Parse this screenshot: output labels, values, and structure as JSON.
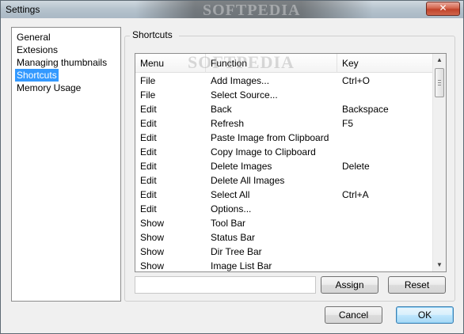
{
  "window": {
    "title": "Settings",
    "title_watermark": "SOFTPEDIA",
    "close_label": "✕"
  },
  "nav": {
    "items": [
      {
        "label": "General",
        "selected": false
      },
      {
        "label": "Extesions",
        "selected": false
      },
      {
        "label": "Managing thumbnails",
        "selected": false
      },
      {
        "label": "Shortcuts",
        "selected": true
      },
      {
        "label": "Memory Usage",
        "selected": false
      }
    ]
  },
  "shortcuts": {
    "group_title": "Shortcuts",
    "watermark": "SOFTPEDIA",
    "columns": [
      "Menu",
      "Function",
      "Key"
    ],
    "rows": [
      {
        "menu": "File",
        "function": "Add Images...",
        "key": "Ctrl+O"
      },
      {
        "menu": "File",
        "function": "Select Source...",
        "key": ""
      },
      {
        "menu": "Edit",
        "function": "Back",
        "key": "Backspace"
      },
      {
        "menu": "Edit",
        "function": "Refresh",
        "key": "F5"
      },
      {
        "menu": "Edit",
        "function": "Paste Image from Clipboard",
        "key": ""
      },
      {
        "menu": "Edit",
        "function": "Copy Image to Clipboard",
        "key": ""
      },
      {
        "menu": "Edit",
        "function": "Delete Images",
        "key": "Delete"
      },
      {
        "menu": "Edit",
        "function": "Delete All Images",
        "key": ""
      },
      {
        "menu": "Edit",
        "function": "Select All",
        "key": "Ctrl+A"
      },
      {
        "menu": "Edit",
        "function": "Options...",
        "key": ""
      },
      {
        "menu": "Show",
        "function": "Tool Bar",
        "key": ""
      },
      {
        "menu": "Show",
        "function": "Status Bar",
        "key": ""
      },
      {
        "menu": "Show",
        "function": "Dir Tree Bar",
        "key": ""
      },
      {
        "menu": "Show",
        "function": "Image List Bar",
        "key": ""
      }
    ],
    "key_field_value": "",
    "assign_label": "Assign",
    "reset_label": "Reset"
  },
  "footer": {
    "cancel_label": "Cancel",
    "ok_label": "OK"
  },
  "colors": {
    "selection": "#3399ff",
    "close_button": "#c0432a",
    "default_button_border": "#3c7fb1"
  }
}
